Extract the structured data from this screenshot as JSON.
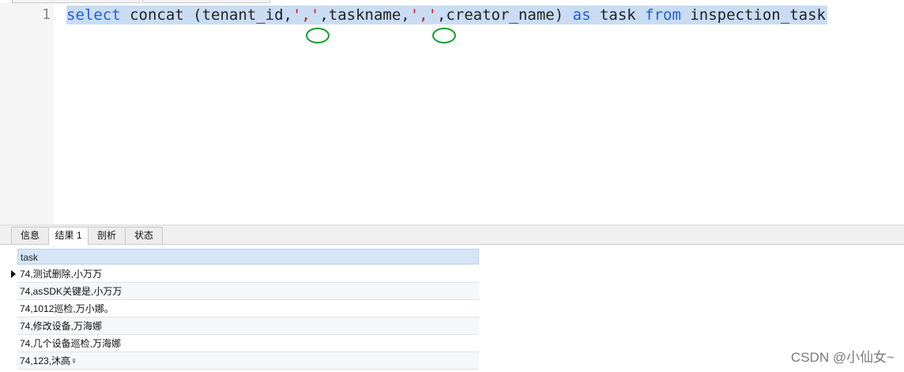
{
  "editor": {
    "line_number": "1",
    "tokens": {
      "select": "select",
      "concat_open": " concat (tenant_id,",
      "str1": "','",
      "taskname": ",taskname,",
      "str2": "','",
      "creator": ",creator_name) ",
      "as": "as",
      "task": " task ",
      "from": "from",
      "table": " inspection_task"
    }
  },
  "panel_tabs": [
    "信息",
    "结果 1",
    "剖析",
    "状态"
  ],
  "active_tab": "结果 1",
  "grid": {
    "column": "task",
    "rows": [
      "74,测试删除,小万万",
      "74,asSDK关键是,小万万",
      "74,1012巡检,万小娜。",
      "74,修改设备,万海娜",
      "74,几个设备巡检,万海娜",
      "74,123,沐高♀"
    ]
  },
  "watermark": "CSDN @小仙女~",
  "colors": {
    "keyword": "#1f5fd6",
    "string": "#d01818",
    "selection": "#c9dcf3",
    "annotation_circle": "#16a02a"
  }
}
